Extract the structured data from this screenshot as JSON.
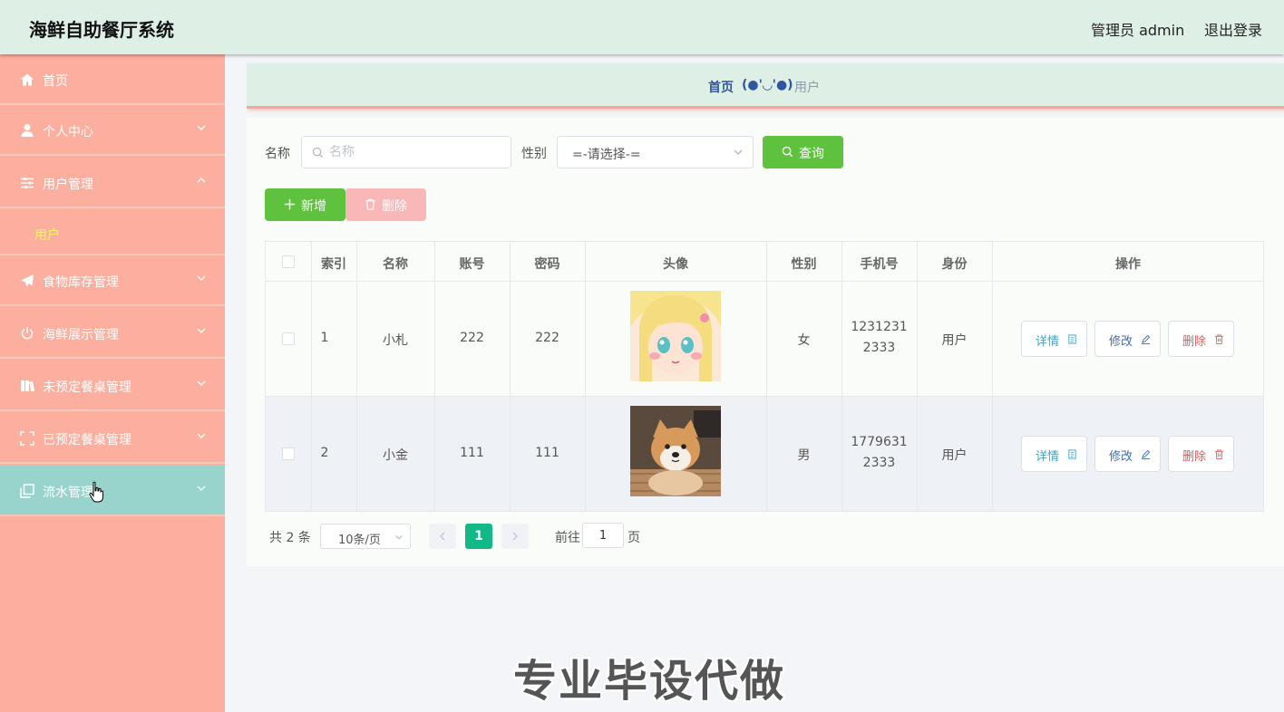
{
  "header": {
    "title": "海鲜自助餐厅系统",
    "admin_label": "管理员 admin",
    "logout_label": "退出登录"
  },
  "sidebar": {
    "items": [
      {
        "label": "首页",
        "icon": "home-icon"
      },
      {
        "label": "个人中心",
        "icon": "user-icon"
      },
      {
        "label": "用户管理",
        "icon": "sliders-icon",
        "expanded": true
      },
      {
        "label": "食物库存管理",
        "icon": "paper-plane-icon"
      },
      {
        "label": "海鲜展示管理",
        "icon": "power-icon"
      },
      {
        "label": "未预定餐桌管理",
        "icon": "book-icon"
      },
      {
        "label": "已预定餐桌管理",
        "icon": "fullscreen-icon"
      },
      {
        "label": "流水管理",
        "icon": "copy-icon",
        "active": true
      }
    ],
    "sub_item": "用户"
  },
  "breadcrumb": {
    "home": "首页",
    "face": "(●'◡'●)",
    "current": "用户"
  },
  "search": {
    "name_label": "名称",
    "name_placeholder": "名称",
    "gender_label": "性别",
    "gender_value": "=-请选择-=",
    "query_label": "查询"
  },
  "actions": {
    "add_label": "新增",
    "delete_label": "删除"
  },
  "table": {
    "headers": [
      "索引",
      "名称",
      "账号",
      "密码",
      "头像",
      "性别",
      "手机号",
      "身份",
      "操作"
    ],
    "rows": [
      {
        "index": "1",
        "name": "小札",
        "account": "222",
        "password": "222",
        "avatar": "anime-girl-avatar",
        "gender": "女",
        "phone_line1": "1231231",
        "phone_line2": "2333",
        "role": "用户"
      },
      {
        "index": "2",
        "name": "小金",
        "account": "111",
        "password": "111",
        "avatar": "shiba-dog-avatar",
        "gender": "男",
        "phone_line1": "1779631",
        "phone_line2": "2333",
        "role": "用户"
      }
    ],
    "row_actions": {
      "detail": "详情",
      "edit": "修改",
      "delete": "删除"
    }
  },
  "pagination": {
    "total": "共 2 条",
    "page_size": "10条/页",
    "current_page": "1",
    "goto_label": "前往",
    "goto_value": "1",
    "page_suffix": "页"
  },
  "watermark": "专业毕设代做",
  "colors": {
    "topbar": "#deefe6",
    "sidebar": "#fdaf9f",
    "active_menu": "#98d4cc",
    "primary_green": "#5ec23f",
    "danger_light": "#f9b7b7",
    "page_active": "#12b886"
  }
}
